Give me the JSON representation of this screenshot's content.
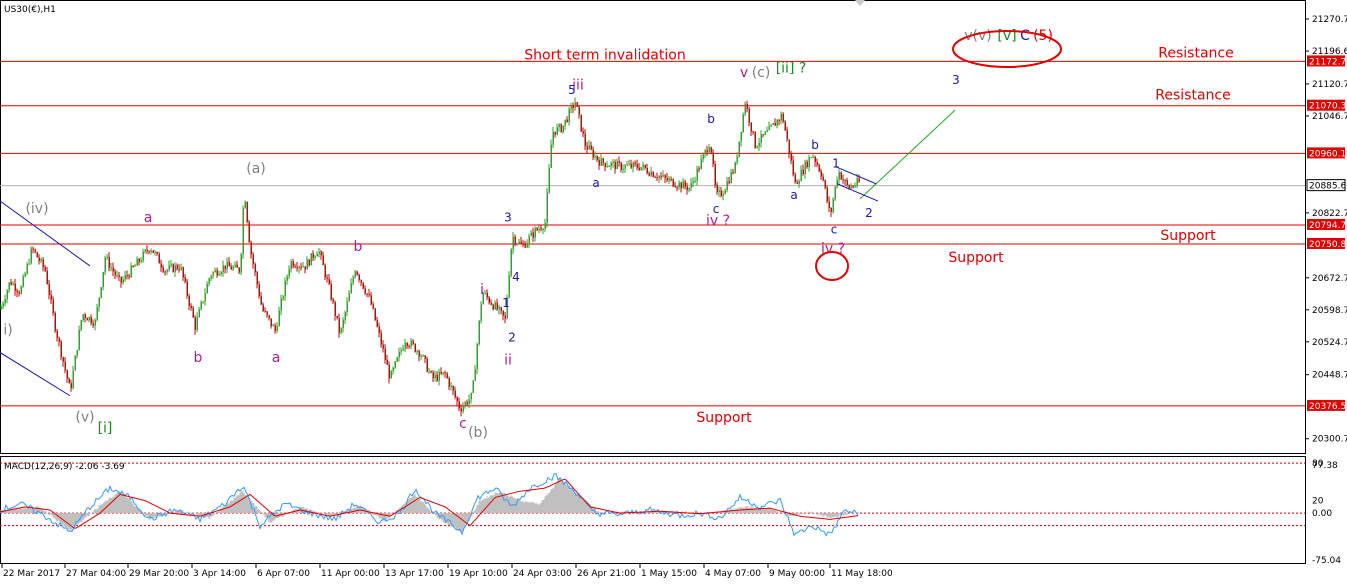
{
  "chart_data": {
    "type": "line",
    "title": "US30(€),H1",
    "colors": {
      "up": "#22aa22",
      "down": "#cc0000",
      "level": "#e00000",
      "grid_dash": "#cc0000",
      "wave_blue": "#1a1aa6",
      "wave_magenta": "#b0208a",
      "wave_gray": "#808080",
      "wave_green": "#1a8a1a",
      "projection": "#22aa22",
      "channel": "#1a1aa6",
      "macd_hist": "#c0c0c0",
      "macd_line": "#3399ff",
      "signal_line": "#e00000"
    },
    "ylim": [
      20270,
      21310
    ],
    "y_ticks": [
      21270.7,
      21196.6,
      21120.7,
      21046.7,
      20822.7,
      20672.7,
      20598.7,
      20524.7,
      20448.7,
      20300.7
    ],
    "x_ticks": [
      "22 Mar 2017",
      "27 Mar 04:00",
      "29 Mar 20:00",
      "3 Apr 14:00",
      "6 Apr 07:00",
      "11 Apr 00:00",
      "13 Apr 17:00",
      "19 Apr 10:00",
      "24 Apr 03:00",
      "26 Apr 21:00",
      "1 May 15:00",
      "4 May 07:00",
      "9 May 00:00",
      "11 May 18:00"
    ],
    "levels": [
      {
        "value": 21172.7,
        "label": "21172.7",
        "text": "Resistance"
      },
      {
        "value": 21070.3,
        "label": "21070.3",
        "text": "Resistance"
      },
      {
        "value": 20960.1,
        "label": "20960.1",
        "text": ""
      },
      {
        "value": 20794.7,
        "label": "20794.7",
        "text": "Support"
      },
      {
        "value": 20750.8,
        "label": "20750.8",
        "text": "Support"
      },
      {
        "value": 20376.5,
        "label": "20376.5",
        "text": "Support"
      }
    ],
    "current_price": {
      "value": 20885.6,
      "label": "20885.6"
    },
    "short_term_invalidation": "Short term invalidation",
    "price_path": [
      [
        0,
        20600
      ],
      [
        10,
        20665
      ],
      [
        20,
        20640
      ],
      [
        32,
        20740
      ],
      [
        45,
        20690
      ],
      [
        55,
        20560
      ],
      [
        70,
        20410
      ],
      [
        82,
        20590
      ],
      [
        95,
        20570
      ],
      [
        105,
        20720
      ],
      [
        120,
        20660
      ],
      [
        135,
        20700
      ],
      [
        150,
        20745
      ],
      [
        165,
        20690
      ],
      [
        180,
        20700
      ],
      [
        195,
        20560
      ],
      [
        210,
        20680
      ],
      [
        225,
        20700
      ],
      [
        240,
        20690
      ],
      [
        244,
        20880
      ],
      [
        250,
        20740
      ],
      [
        262,
        20600
      ],
      [
        275,
        20550
      ],
      [
        290,
        20710
      ],
      [
        305,
        20700
      ],
      [
        318,
        20740
      ],
      [
        330,
        20640
      ],
      [
        340,
        20540
      ],
      [
        355,
        20695
      ],
      [
        370,
        20620
      ],
      [
        390,
        20440
      ],
      [
        405,
        20530
      ],
      [
        420,
        20500
      ],
      [
        432,
        20440
      ],
      [
        445,
        20450
      ],
      [
        460,
        20370
      ],
      [
        472,
        20400
      ],
      [
        482,
        20640
      ],
      [
        497,
        20600
      ],
      [
        505,
        20575
      ],
      [
        512,
        20770
      ],
      [
        522,
        20745
      ],
      [
        535,
        20780
      ],
      [
        545,
        20800
      ],
      [
        552,
        21010
      ],
      [
        562,
        21020
      ],
      [
        575,
        21080
      ],
      [
        585,
        20980
      ],
      [
        600,
        20940
      ],
      [
        620,
        20930
      ],
      [
        640,
        20930
      ],
      [
        665,
        20900
      ],
      [
        690,
        20880
      ],
      [
        710,
        20990
      ],
      [
        716,
        20860
      ],
      [
        722,
        20870
      ],
      [
        735,
        20930
      ],
      [
        745,
        21080
      ],
      [
        755,
        20980
      ],
      [
        768,
        21010
      ],
      [
        782,
        21050
      ],
      [
        795,
        20890
      ],
      [
        812,
        20960
      ],
      [
        822,
        20910
      ],
      [
        830,
        20815
      ],
      [
        838,
        20920
      ],
      [
        848,
        20880
      ],
      [
        860,
        20895
      ]
    ],
    "projection": [
      [
        860,
        20855
      ],
      [
        955,
        21060
      ]
    ],
    "channel_upper": [
      [
        835,
        20930
      ],
      [
        876,
        20890
      ]
    ],
    "channel_lower": [
      [
        837,
        20890
      ],
      [
        878,
        20850
      ]
    ],
    "left_channel_upper": [
      [
        0,
        20850
      ],
      [
        90,
        20700
      ]
    ],
    "left_channel_lower": [
      [
        0,
        20500
      ],
      [
        70,
        20400
      ]
    ],
    "annotations": [
      {
        "text": "v(v)",
        "x": 978,
        "y": 21222,
        "color": "#808080",
        "cls": "ann"
      },
      {
        "text": "[v]",
        "x": 1007,
        "y": 21222,
        "color": "#1a8a1a",
        "cls": "ann"
      },
      {
        "text": "C",
        "x": 1025,
        "y": 21222,
        "color": "#1a1aa6",
        "cls": "ann"
      },
      {
        "text": "(5)",
        "x": 1043,
        "y": 21222,
        "color": "#e00000",
        "cls": "ann"
      },
      {
        "text": "v",
        "x": 744,
        "y": 21137,
        "color": "#b0208a",
        "cls": "ann"
      },
      {
        "text": "(c)",
        "x": 761,
        "y": 21137,
        "color": "#808080",
        "cls": "ann"
      },
      {
        "text": "[ii] ?",
        "x": 791,
        "y": 21147,
        "color": "#1a8a1a",
        "cls": "ann"
      },
      {
        "text": "3",
        "x": 956,
        "y": 21121,
        "color": "#1a1aa6",
        "cls": "ann-sm"
      },
      {
        "text": "iii",
        "x": 578,
        "y": 21108,
        "color": "#b0208a",
        "cls": "ann"
      },
      {
        "text": "(a)",
        "x": 256,
        "y": 20915,
        "color": "#808080",
        "cls": "ann"
      },
      {
        "text": "(iv)",
        "x": 37,
        "y": 20822,
        "color": "#808080",
        "cls": "ann"
      },
      {
        "text": "a",
        "x": 148,
        "y": 20802,
        "color": "#b0208a",
        "cls": "ann"
      },
      {
        "text": "b",
        "x": 358,
        "y": 20735,
        "color": "#b0208a",
        "cls": "ann"
      },
      {
        "text": "i)",
        "x": 8,
        "y": 20542,
        "color": "#808080",
        "cls": "ann"
      },
      {
        "text": "b",
        "x": 198,
        "y": 20478,
        "color": "#b0208a",
        "cls": "ann"
      },
      {
        "text": "a",
        "x": 276,
        "y": 20478,
        "color": "#b0208a",
        "cls": "ann"
      },
      {
        "text": "(v)",
        "x": 85,
        "y": 20340,
        "color": "#808080",
        "cls": "ann"
      },
      {
        "text": "[i]",
        "x": 105,
        "y": 20315,
        "color": "#1a8a1a",
        "cls": "ann"
      },
      {
        "text": "c",
        "x": 463,
        "y": 20326,
        "color": "#b0208a",
        "cls": "ann"
      },
      {
        "text": "(b)",
        "x": 478,
        "y": 20305,
        "color": "#808080",
        "cls": "ann"
      },
      {
        "text": "i",
        "x": 482,
        "y": 20635,
        "color": "#b0208a",
        "cls": "ann"
      },
      {
        "text": "ii",
        "x": 508,
        "y": 20472,
        "color": "#b0208a",
        "cls": "ann"
      },
      {
        "text": "1",
        "x": 506,
        "y": 20605,
        "color": "#1a1aa6",
        "cls": "ann-sm"
      },
      {
        "text": "2",
        "x": 512,
        "y": 20525,
        "color": "#1a1aa6",
        "cls": "ann-sm"
      },
      {
        "text": "3",
        "x": 508,
        "y": 20803,
        "color": "#1a1aa6",
        "cls": "ann-sm"
      },
      {
        "text": "4",
        "x": 516,
        "y": 20665,
        "color": "#1a1aa6",
        "cls": "ann-sm"
      },
      {
        "text": "5",
        "x": 572,
        "y": 21097,
        "color": "#1a1aa6",
        "cls": "ann-sm"
      },
      {
        "text": "a",
        "x": 596,
        "y": 20882,
        "color": "#1a1aa6",
        "cls": "ann-sm"
      },
      {
        "text": "b",
        "x": 711,
        "y": 21030,
        "color": "#1a1aa6",
        "cls": "ann-sm"
      },
      {
        "text": "c",
        "x": 716,
        "y": 20822,
        "color": "#1a1aa6",
        "cls": "ann-sm"
      },
      {
        "text": "iv ?",
        "x": 718,
        "y": 20795,
        "color": "#b0208a",
        "cls": "ann"
      },
      {
        "text": "b",
        "x": 815,
        "y": 20970,
        "color": "#1a1aa6",
        "cls": "ann-sm"
      },
      {
        "text": "a",
        "x": 794,
        "y": 20855,
        "color": "#1a1aa6",
        "cls": "ann-sm"
      },
      {
        "text": "1",
        "x": 836,
        "y": 20928,
        "color": "#1a1aa6",
        "cls": "ann-sm"
      },
      {
        "text": "c",
        "x": 834,
        "y": 20775,
        "color": "#1a1aa6",
        "cls": "ann-sm"
      },
      {
        "text": "2",
        "x": 869,
        "y": 20813,
        "color": "#1a1aa6",
        "cls": "ann-sm"
      },
      {
        "text": "iv ?",
        "x": 833,
        "y": 20730,
        "color": "#b0208a",
        "cls": "ann"
      }
    ],
    "macd": {
      "label": "MACD(12,26,9) -2.06 -3.69",
      "ylim": [
        -75.04,
        85
      ],
      "y_ticks": [
        "77.38",
        "80",
        "0.00",
        "20",
        "-75.04"
      ],
      "levels": [
        80,
        0,
        -20
      ],
      "hist": [
        [
          0,
          5
        ],
        [
          40,
          10
        ],
        [
          70,
          -28
        ],
        [
          100,
          12
        ],
        [
          120,
          35
        ],
        [
          150,
          -10
        ],
        [
          180,
          5
        ],
        [
          210,
          -8
        ],
        [
          243,
          35
        ],
        [
          270,
          -15
        ],
        [
          300,
          10
        ],
        [
          330,
          -5
        ],
        [
          360,
          12
        ],
        [
          385,
          -12
        ],
        [
          415,
          30
        ],
        [
          440,
          -10
        ],
        [
          462,
          -30
        ],
        [
          480,
          20
        ],
        [
          500,
          35
        ],
        [
          520,
          20
        ],
        [
          540,
          15
        ],
        [
          560,
          55
        ],
        [
          578,
          30
        ],
        [
          600,
          0
        ],
        [
          640,
          2
        ],
        [
          680,
          3
        ],
        [
          700,
          -2
        ],
        [
          720,
          2
        ],
        [
          745,
          10
        ],
        [
          770,
          8
        ],
        [
          790,
          -5
        ],
        [
          810,
          2
        ],
        [
          830,
          -8
        ],
        [
          858,
          2
        ]
      ],
      "line": [
        [
          0,
          5
        ],
        [
          20,
          15
        ],
        [
          40,
          0
        ],
        [
          70,
          -30
        ],
        [
          90,
          10
        ],
        [
          110,
          40
        ],
        [
          130,
          25
        ],
        [
          150,
          -10
        ],
        [
          175,
          5
        ],
        [
          200,
          -10
        ],
        [
          225,
          15
        ],
        [
          243,
          45
        ],
        [
          260,
          -20
        ],
        [
          285,
          15
        ],
        [
          310,
          0
        ],
        [
          335,
          -10
        ],
        [
          355,
          15
        ],
        [
          380,
          -15
        ],
        [
          400,
          0
        ],
        [
          415,
          40
        ],
        [
          435,
          0
        ],
        [
          462,
          -30
        ],
        [
          478,
          25
        ],
        [
          495,
          40
        ],
        [
          512,
          10
        ],
        [
          530,
          40
        ],
        [
          555,
          60
        ],
        [
          575,
          35
        ],
        [
          595,
          0
        ],
        [
          620,
          -2
        ],
        [
          650,
          5
        ],
        [
          680,
          -4
        ],
        [
          700,
          0
        ],
        [
          720,
          -8
        ],
        [
          740,
          25
        ],
        [
          760,
          10
        ],
        [
          780,
          20
        ],
        [
          795,
          -35
        ],
        [
          812,
          -20
        ],
        [
          830,
          -35
        ],
        [
          845,
          5
        ],
        [
          858,
          -2
        ]
      ],
      "signal": [
        [
          0,
          2
        ],
        [
          25,
          10
        ],
        [
          50,
          5
        ],
        [
          75,
          -25
        ],
        [
          100,
          0
        ],
        [
          120,
          30
        ],
        [
          145,
          20
        ],
        [
          170,
          0
        ],
        [
          200,
          -5
        ],
        [
          230,
          10
        ],
        [
          250,
          30
        ],
        [
          275,
          -5
        ],
        [
          300,
          5
        ],
        [
          330,
          -5
        ],
        [
          360,
          5
        ],
        [
          390,
          -5
        ],
        [
          420,
          25
        ],
        [
          445,
          10
        ],
        [
          470,
          -20
        ],
        [
          495,
          25
        ],
        [
          520,
          35
        ],
        [
          545,
          40
        ],
        [
          565,
          55
        ],
        [
          590,
          10
        ],
        [
          620,
          0
        ],
        [
          660,
          3
        ],
        [
          700,
          -1
        ],
        [
          740,
          5
        ],
        [
          770,
          8
        ],
        [
          800,
          -5
        ],
        [
          830,
          -10
        ],
        [
          858,
          -4
        ]
      ]
    }
  }
}
